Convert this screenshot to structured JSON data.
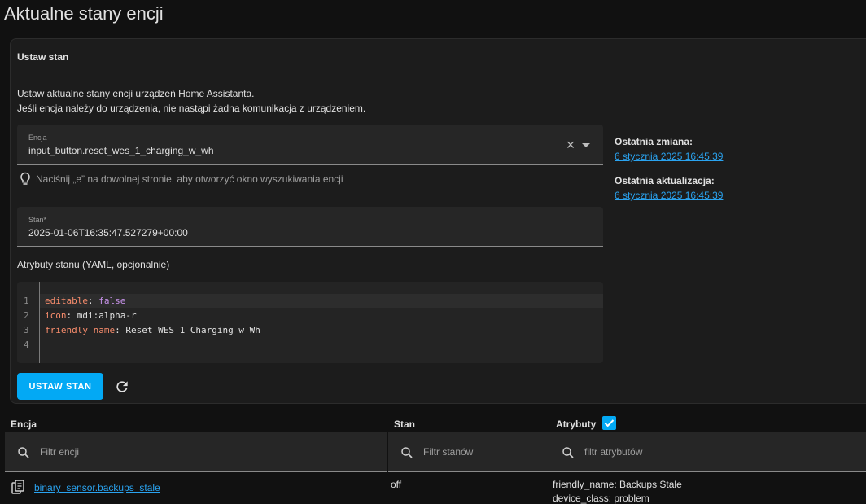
{
  "page": {
    "title": "Aktualne stany encji"
  },
  "card": {
    "title": "Ustaw stan",
    "intro_line1": "Ustaw aktualne stany encji urządzeń Home Assistanta.",
    "intro_line2": "Jeśli encja należy do urządzenia, nie nastąpi żadna komunikacja z urządzeniem."
  },
  "entity_field": {
    "label": "Encja",
    "value": "input_button.reset_wes_1_charging_w_wh"
  },
  "hint": {
    "text": "Naciśnij „e” na dowolnej stronie, aby otworzyć okno wyszukiwania encji"
  },
  "state_field": {
    "label": "Stan*",
    "value": "2025-01-06T16:35:47.527279+00:00"
  },
  "side": {
    "last_changed_label": "Ostatnia zmiana:",
    "last_changed_value": "6 stycznia 2025 16:45:39",
    "last_updated_label": "Ostatnia aktualizacja:",
    "last_updated_value": "6 stycznia 2025 16:45:39"
  },
  "attributes": {
    "label": "Atrybuty stanu (YAML, opcjonalnie)",
    "line_numbers": [
      "1",
      "2",
      "3",
      "4"
    ],
    "lines": [
      {
        "key": "editable",
        "sep": ": ",
        "value": "false"
      },
      {
        "key": "icon",
        "sep": ": ",
        "value": "mdi:alpha-r"
      },
      {
        "key": "friendly_name",
        "sep": ": ",
        "value": "Reset WES 1 Charging w Wh"
      }
    ]
  },
  "buttons": {
    "set_state": "USTAW STAN",
    "refresh_icon": "refresh-icon"
  },
  "table": {
    "col_entity": "Encja",
    "col_state": "Stan",
    "col_attributes": "Atrybuty",
    "attributes_checked": true,
    "filter_entity_placeholder": "Filtr encji",
    "filter_state_placeholder": "Filtr stanów",
    "filter_attr_placeholder": "filtr atrybutów",
    "rows": [
      {
        "entity": "binary_sensor.backups_stale",
        "state": "off",
        "attr_line1": "friendly_name: Backups Stale",
        "attr_line2": "device_class: problem"
      }
    ]
  },
  "colors": {
    "accent": "#03a9f4",
    "link": "#2aa3f0",
    "background": "#111111",
    "card": "#1c1c1c"
  }
}
